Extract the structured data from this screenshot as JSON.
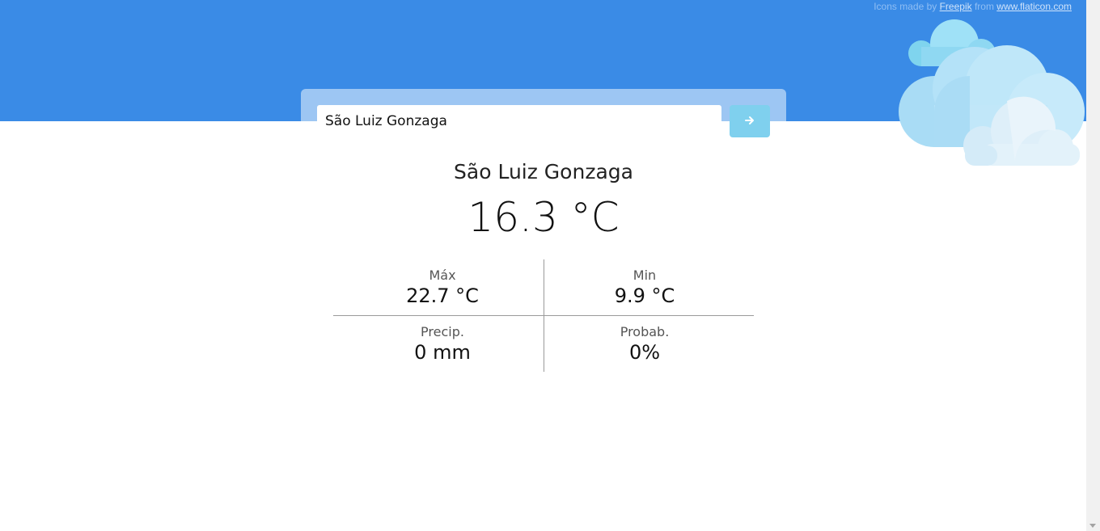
{
  "credits": {
    "prefix": "Icons made by",
    "author_link": "Freepik",
    "middle": "from",
    "site_link": "www.flaticon.com"
  },
  "search": {
    "value": "São Luiz Gonzaga",
    "button_icon": "arrow-right-icon"
  },
  "weather": {
    "city": "São Luiz Gonzaga",
    "temperature": "16.3 °C",
    "stats": [
      {
        "label": "Máx",
        "value": "22.7 °C"
      },
      {
        "label": "Min",
        "value": "9.9 °C"
      },
      {
        "label": "Precip.",
        "value": "0 mm"
      },
      {
        "label": "Probab.",
        "value": "0%"
      }
    ]
  },
  "colors": {
    "banner": "#3a8be6",
    "search_panel": "#9dc6f3",
    "button": "#7fd0ee"
  },
  "decoration": {
    "icon": "clouds-icon"
  }
}
